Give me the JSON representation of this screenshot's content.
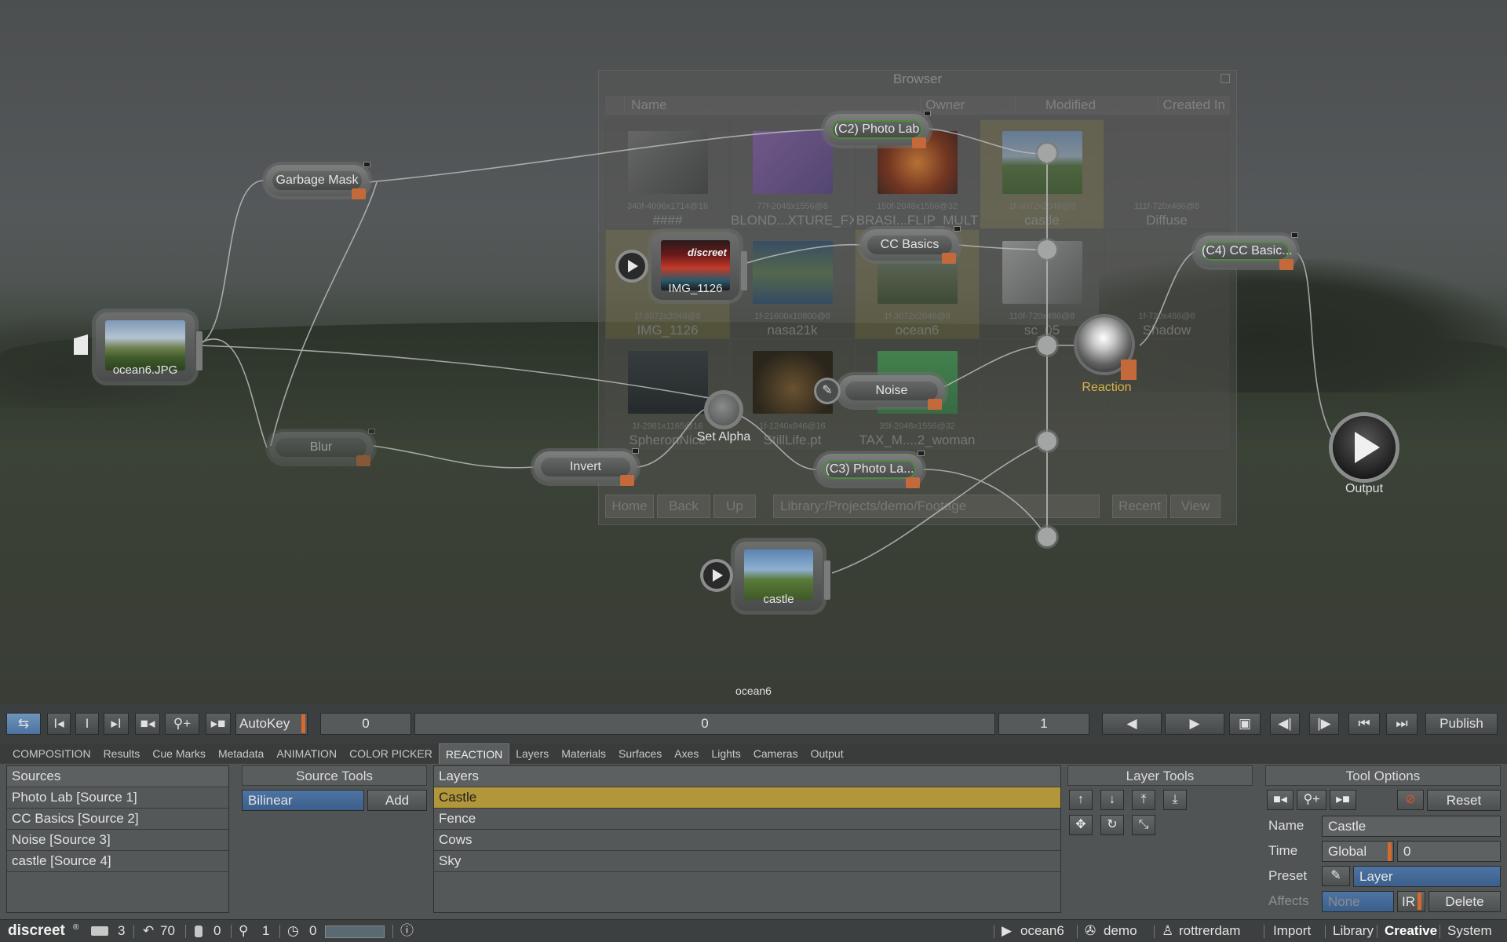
{
  "browser": {
    "title": "Browser",
    "columns": [
      "Name",
      "Owner",
      "Modified",
      "Created In"
    ],
    "cells": [
      {
        "info": "340f-4096x1714@16",
        "name": "####"
      },
      {
        "info": "77f-2048x1556@8",
        "name": "BLOND...XTURE_FX"
      },
      {
        "info": "150f-2048x1556@32",
        "name": "BRASI...FLIP_MULT"
      },
      {
        "info": "1f-3072x2048@8",
        "name": "castle"
      },
      {
        "info": "111f-720x486@8",
        "name": "Diffuse"
      },
      {
        "info": "1f-3072x2048@8",
        "name": "IMG_1126"
      },
      {
        "info": "1f-21600x10800@8",
        "name": "nasa21k"
      },
      {
        "info": "1f-3072x2048@8",
        "name": "ocean6"
      },
      {
        "info": "110f-720x486@8",
        "name": "sc_05"
      },
      {
        "info": "1f-720x486@8",
        "name": "Shadow"
      },
      {
        "info": "1f-2981x1165@16",
        "name": "SpheronNice"
      },
      {
        "info": "1f-1240x846@16",
        "name": "StillLife.pt"
      },
      {
        "info": "35f-2048x1556@32",
        "name": "TAX_M....2_woman"
      }
    ],
    "buttons": [
      "Home",
      "Back",
      "Up"
    ],
    "path": "Library:/Projects/demo/Footage",
    "right_buttons": [
      "Recent",
      "View"
    ]
  },
  "graph": {
    "nodes": {
      "garbage_mask": "Garbage Mask",
      "photo_lab_c2": "(C2) Photo Lab",
      "cc_basics": "CC Basics",
      "cc_basics_c4": "(C4) CC Basic...",
      "blur": "Blur",
      "invert": "Invert",
      "noise": "Noise",
      "photo_lab_c3": "(C3) Photo La..."
    },
    "images": {
      "ocean": "ocean6.JPG",
      "img1126": "IMG_1126",
      "castle": "castle",
      "img1126_logo": "discreet"
    },
    "labels": {
      "set_alpha": "Set Alpha",
      "reaction": "Reaction",
      "output": "Output",
      "composition_name": "ocean6"
    }
  },
  "transport": {
    "autokey": "AutoKey",
    "start_frame": "0",
    "current_frame": "0",
    "end_frame": "1",
    "publish": "Publish",
    "btn_icons": [
      "I◂",
      "I",
      "▸I"
    ]
  },
  "tabs": [
    {
      "label": "COMPOSITION",
      "active": false
    },
    {
      "label": "Results",
      "active": false
    },
    {
      "label": "Cue Marks",
      "active": false
    },
    {
      "label": "Metadata",
      "active": false
    },
    {
      "label": "ANIMATION",
      "active": false
    },
    {
      "label": "COLOR PICKER",
      "active": false
    },
    {
      "label": "REACTION",
      "active": true
    },
    {
      "label": "Layers",
      "active": false
    },
    {
      "label": "Materials",
      "active": false
    },
    {
      "label": "Surfaces",
      "active": false
    },
    {
      "label": "Axes",
      "active": false
    },
    {
      "label": "Lights",
      "active": false
    },
    {
      "label": "Cameras",
      "active": false
    },
    {
      "label": "Output",
      "active": false
    }
  ],
  "sources": {
    "header": "Sources",
    "items": [
      "Photo Lab [Source 1]",
      "CC Basics [Source 2]",
      "Noise [Source 3]",
      "castle [Source 4]"
    ]
  },
  "source_tools": {
    "header": "Source Tools",
    "filter": "Bilinear",
    "add": "Add"
  },
  "layers": {
    "header": "Layers",
    "items": [
      {
        "label": "Castle",
        "selected": true
      },
      {
        "label": "Fence",
        "selected": false
      },
      {
        "label": "Cows",
        "selected": false
      },
      {
        "label": "Sky",
        "selected": false
      }
    ]
  },
  "layer_tools": {
    "header": "Layer Tools"
  },
  "tool_options": {
    "header": "Tool Options",
    "reset": "Reset",
    "name_label": "Name",
    "name_value": "Castle",
    "time_label": "Time",
    "time_mode": "Global",
    "time_value": "0",
    "preset_label": "Preset",
    "preset_value": "Layer",
    "affects_label": "Affects",
    "affects_value": "None",
    "ir": "IR",
    "delete": "Delete"
  },
  "status": {
    "brand": "discreet",
    "brand_mark": "®",
    "count_a": "3",
    "undo": "70",
    "count_b": "0",
    "count_c": "1",
    "count_d": "0",
    "composition": "ocean6",
    "project": "demo",
    "user": "rottrerdam",
    "menu": [
      "Import",
      "Library",
      "Creative",
      "System"
    ]
  },
  "colors": {
    "accent_selection": "#b2963a",
    "selected_button": "#5a82ad",
    "node_flag": "#c46a3a",
    "autokey_tick": "#d46a2c"
  }
}
